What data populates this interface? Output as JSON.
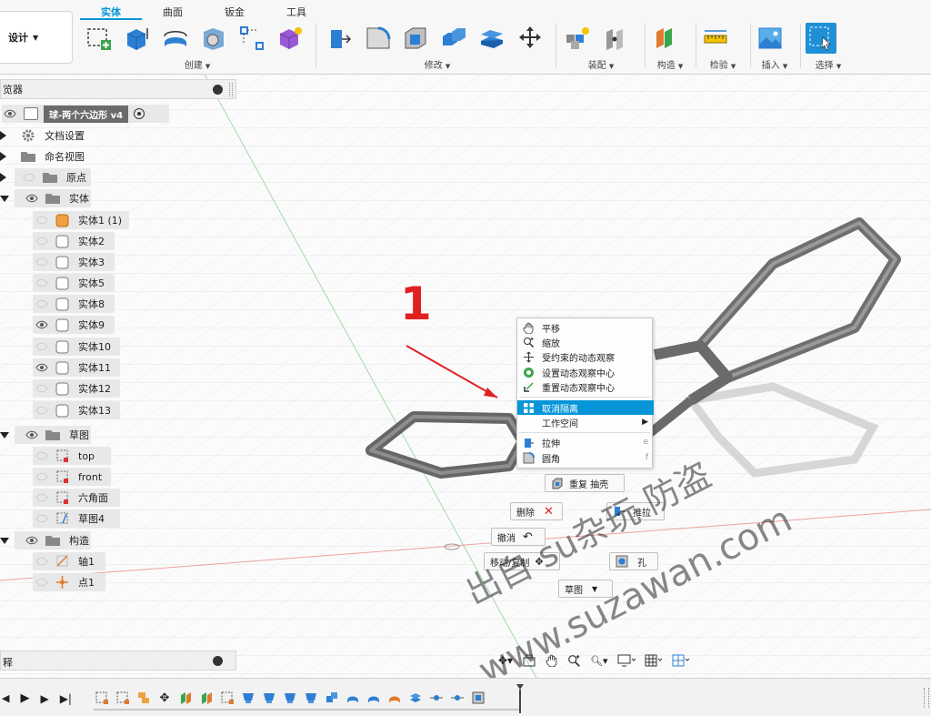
{
  "workspace": {
    "label": "设计"
  },
  "tabs": [
    {
      "label": "实体",
      "active": true
    },
    {
      "label": "曲面"
    },
    {
      "label": "钣金"
    },
    {
      "label": "工具"
    }
  ],
  "toolbar_groups": {
    "create": "创建",
    "modify": "修改",
    "assemble": "装配",
    "construct": "构造",
    "inspect": "检验",
    "insert": "插入",
    "select": "选择"
  },
  "colors": {
    "accent": "#0696d7",
    "annotation": "#e02020"
  },
  "browser": {
    "header": "览器",
    "root": "球-两个六边形 v4",
    "items": [
      {
        "label": "文档设置",
        "icon": "gear-icon"
      },
      {
        "label": "命名视图",
        "icon": "folder-icon"
      },
      {
        "label": "原点",
        "icon": "folder-icon"
      },
      {
        "label": "实体",
        "icon": "folder-icon"
      },
      {
        "label": "实体1 (1)",
        "icon": "body-icon"
      },
      {
        "label": "实体2",
        "icon": "body-icon"
      },
      {
        "label": "实体3",
        "icon": "body-icon"
      },
      {
        "label": "实体5",
        "icon": "body-icon"
      },
      {
        "label": "实体8",
        "icon": "body-icon"
      },
      {
        "label": "实体9",
        "icon": "body-icon"
      },
      {
        "label": "实体10",
        "icon": "body-icon"
      },
      {
        "label": "实体11",
        "icon": "body-icon"
      },
      {
        "label": "实体12",
        "icon": "body-icon"
      },
      {
        "label": "实体13",
        "icon": "body-icon"
      },
      {
        "label": "草图",
        "icon": "folder-icon"
      },
      {
        "label": "top",
        "icon": "sketch-icon"
      },
      {
        "label": "front",
        "icon": "sketch-icon"
      },
      {
        "label": "六角面",
        "icon": "sketch-icon"
      },
      {
        "label": "草图4",
        "icon": "sketch-icon"
      },
      {
        "label": "构造",
        "icon": "folder-icon"
      },
      {
        "label": "轴1",
        "icon": "axis-icon"
      },
      {
        "label": "点1",
        "icon": "point-icon"
      }
    ]
  },
  "comments": {
    "label": "释"
  },
  "context_menu": {
    "items": [
      {
        "label": "平移",
        "icon": "pan-hand-icon"
      },
      {
        "label": "缩放",
        "icon": "zoom-icon"
      },
      {
        "label": "受约束的动态观察",
        "icon": "orbit-icon"
      },
      {
        "label": "设置动态观察中心",
        "icon": "orbit-center-icon"
      },
      {
        "label": "重置动态观察中心",
        "icon": "reset-orbit-icon"
      },
      {
        "label": "取消隔离",
        "icon": "unisolate-icon",
        "highlighted": true
      },
      {
        "label": "工作空间",
        "submenu": true
      },
      {
        "label": "拉伸",
        "shortcut": "e",
        "icon": "extrude-icon"
      },
      {
        "label": "圆角",
        "shortcut": "f",
        "icon": "fillet-icon"
      }
    ]
  },
  "marking_menu": {
    "repeat": "重复 抽壳",
    "delete": "删除",
    "press_pull": "推拉",
    "undo": "撤消",
    "move_copy": "移动/复制",
    "hole": "孔",
    "sketch": "草图"
  },
  "annotation": {
    "number": "1"
  },
  "watermark": {
    "line1": "出自 su杂玩 防盗",
    "line2": "www.suzawan.com"
  }
}
